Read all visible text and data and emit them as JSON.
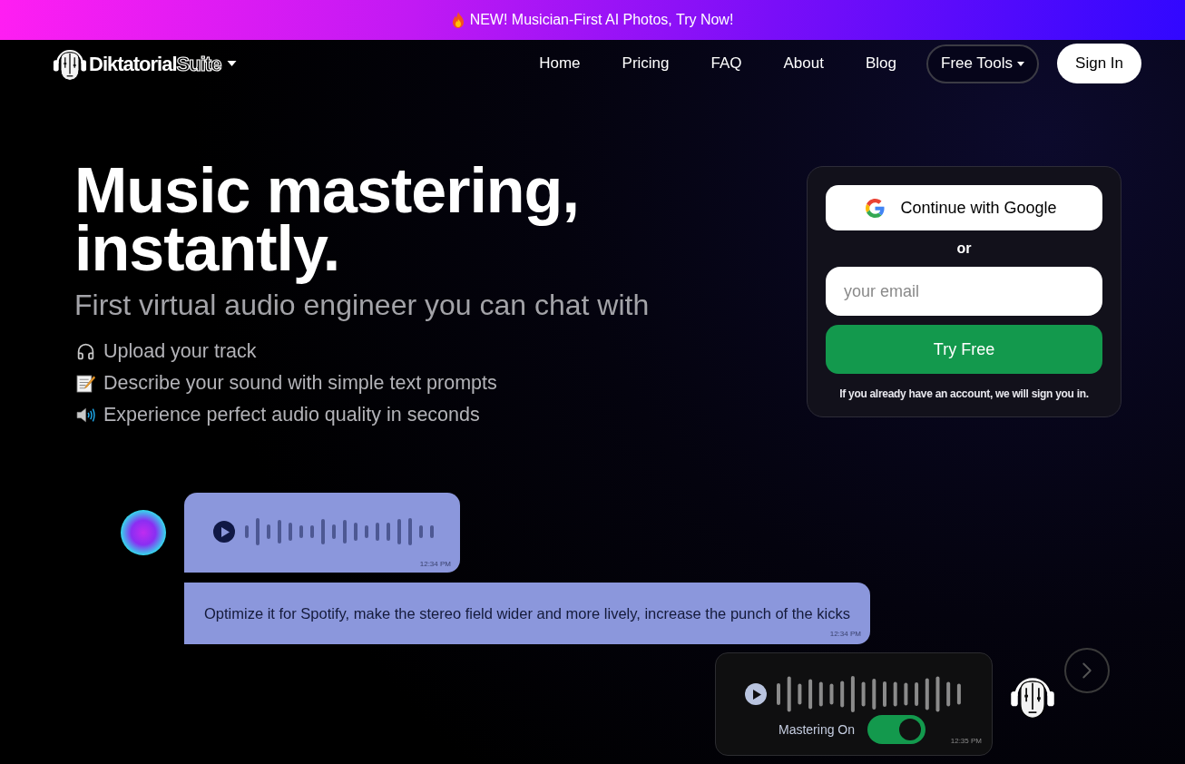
{
  "banner": {
    "text": "NEW! Musician-First AI Photos, Try Now!"
  },
  "nav": {
    "brand": {
      "name": "Diktatorial",
      "suffix": "Suite"
    },
    "items": [
      {
        "label": "Home",
        "kind": "link"
      },
      {
        "label": "Pricing",
        "kind": "link"
      },
      {
        "label": "FAQ",
        "kind": "link"
      },
      {
        "label": "About",
        "kind": "link"
      },
      {
        "label": "Blog",
        "kind": "link"
      },
      {
        "label": "Free Tools",
        "kind": "dropdown"
      },
      {
        "label": "Sign In",
        "kind": "button"
      }
    ]
  },
  "hero": {
    "title": "Music mastering, instantly.",
    "subtitle": "First virtual audio engineer you can chat with",
    "features": [
      "Upload your track",
      "Describe your sound with simple text prompts",
      "Experience perfect audio quality in seconds"
    ]
  },
  "signup": {
    "google_button": "Continue with Google",
    "divider": "or",
    "email": {
      "placeholder": "your email"
    },
    "submit": "Try Free",
    "note": "If you already have an account, we will sign you in."
  },
  "chat": {
    "messages": [
      {
        "kind": "user_voice",
        "show_avatar": true,
        "time": "12:34 PM"
      },
      {
        "kind": "user_text",
        "show_avatar": false,
        "text": "Optimize it for Spotify, make the stereo field wider and more lively, increase the punch of the kicks",
        "time": "12:34 PM"
      },
      {
        "kind": "reply_voice",
        "show_avatar": true,
        "time": "12:35 PM",
        "toggle": {
          "label": "Mastering On",
          "on": true
        }
      }
    ]
  }
}
